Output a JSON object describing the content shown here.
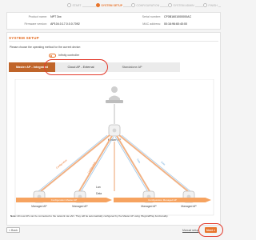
{
  "steps": [
    {
      "label": "START",
      "state": "done"
    },
    {
      "label": "SYSTEM SETUP",
      "state": "active"
    },
    {
      "label": "CONFIGURATION",
      "state": "todo"
    },
    {
      "label": "SYSTEM ADMIN",
      "state": "todo"
    },
    {
      "label": "FINISH",
      "state": "todo"
    }
  ],
  "device_info": {
    "product_name_label": "Product name:",
    "product_name_value": "NPT 3xx",
    "firmware_label": "Firmware version:",
    "firmware_value": "AP104.0.17.0.0.0.7092",
    "serial_label": "Serial number:",
    "serial_value": "CF0B1601000000AC",
    "mac_label": "MAC address:",
    "mac_value": "00:16:96:60:40:00"
  },
  "setup": {
    "section_title": "SYSTEM SETUP",
    "instruction": "Please choose the operating method for the current device:",
    "toggle_label": "Infinity controller",
    "tabs": [
      "Master AP - Integrated",
      "Cloud AP - External",
      "Standalone AP"
    ],
    "active_tab": 0
  },
  "diagram": {
    "master_label": "Master AP",
    "managed_label": "Managed AP",
    "managed_count": 4,
    "link_labels": [
      "Configuration",
      "Configuration",
      "Data",
      "Data"
    ],
    "legend_lan": "Lan",
    "legend_data": "Data",
    "flow_left": "Configuration Master AP",
    "flow_right": "Configuration Managed AP"
  },
  "note": {
    "bold": "Note:",
    "text": " All new APs can be connected to the network via LAN. They will be automatically configured by the Master AP using PlugAndPlay functionality."
  },
  "footer": {
    "back_label": "< Back",
    "manual_label": "Manual setup",
    "next_label": "Next >"
  },
  "colors": {
    "accent": "#e8742b",
    "highlight_ring": "#e33b2d",
    "config_link": "#e8742b",
    "data_link": "#6aa6d8"
  }
}
